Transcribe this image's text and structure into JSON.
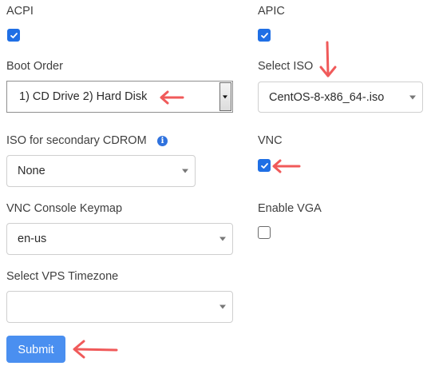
{
  "form": {
    "acpi": {
      "label": "ACPI",
      "checked": true
    },
    "apic": {
      "label": "APIC",
      "checked": true
    },
    "boot_order": {
      "label": "Boot Order",
      "value": "1) CD Drive 2) Hard Disk"
    },
    "select_iso": {
      "label": "Select ISO",
      "value": "CentOS-8-x86_64-.iso"
    },
    "secondary_cdrom": {
      "label": "ISO for secondary CDROM",
      "value": "None",
      "icon": "info-icon"
    },
    "vnc": {
      "label": "VNC",
      "checked": true
    },
    "vnc_keymap": {
      "label": "VNC Console Keymap",
      "value": "en-us"
    },
    "enable_vga": {
      "label": "Enable VGA",
      "checked": false
    },
    "vps_timezone": {
      "label": "Select VPS Timezone",
      "value": ""
    },
    "submit_label": "Submit"
  },
  "annotations": {
    "arrow_color": "#f05a5a"
  },
  "colors": {
    "accent": "#1f6fe5",
    "button": "#4a8ff0"
  }
}
